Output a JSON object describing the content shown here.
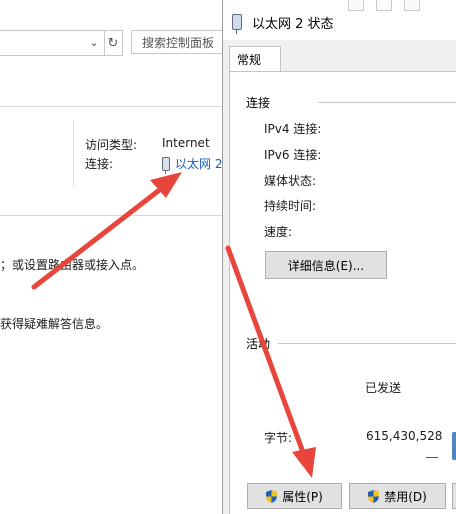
{
  "background": {
    "search_placeholder": "搜索控制面板",
    "access_type_label": "访问类型:",
    "access_type_value": "Internet",
    "connection_label": "连接:",
    "connection_value": "以太网 2",
    "line1": "；或设置路由器或接入点。",
    "line2": "获得疑难解答信息。"
  },
  "dialog": {
    "title": "以太网 2 状态",
    "tab_general": "常规",
    "connection_group": "连接",
    "fields": [
      "IPv4 连接:",
      "IPv6 连接:",
      "媒体状态:",
      "持续时间:",
      "速度:"
    ],
    "details_button": "详细信息(E)...",
    "activity_group": "活动",
    "sent_label": "已发送",
    "bytes_label": "字节:",
    "bytes_sent": "615,430,528",
    "properties_button": "属性(P)",
    "disable_button": "禁用(D)"
  },
  "colors": {
    "link": "#1a5fb4",
    "arrow": "#e8453c"
  }
}
